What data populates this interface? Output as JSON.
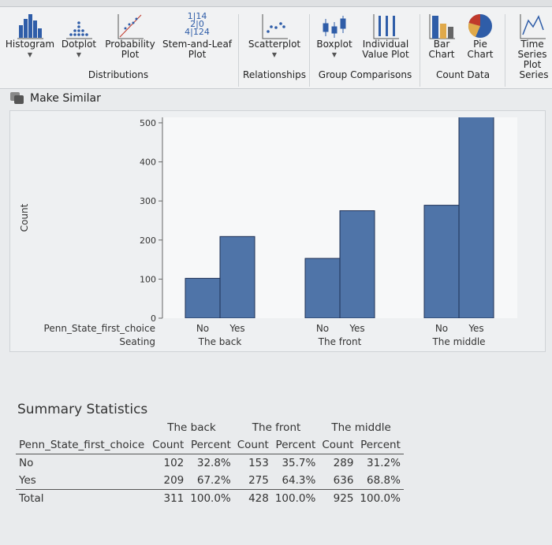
{
  "ribbon": {
    "tools": [
      {
        "label": "Histogram",
        "icon": "histogram-icon"
      },
      {
        "label": "Dotplot",
        "icon": "dotplot-icon"
      },
      {
        "label": "Probability Plot",
        "icon": "probability-plot-icon"
      },
      {
        "label": "Stem-and-Leaf Plot",
        "icon": "stem-leaf-icon"
      },
      {
        "label": "Scatterplot",
        "icon": "scatterplot-icon"
      },
      {
        "label": "Boxplot",
        "icon": "boxplot-icon"
      },
      {
        "label": "Individual Value Plot",
        "icon": "individual-value-plot-icon"
      },
      {
        "label": "Bar Chart",
        "icon": "bar-chart-icon"
      },
      {
        "label": "Pie Chart",
        "icon": "pie-chart-icon"
      },
      {
        "label": "Time Series Plot",
        "icon": "time-series-icon"
      }
    ],
    "stem_leaf_text": [
      "1|14",
      "2|0",
      "4|124"
    ],
    "groups": [
      "Distributions",
      "Relationships",
      "Group Comparisons",
      "Count Data",
      "Series"
    ],
    "make_similar": "Make Similar"
  },
  "chart_data": {
    "type": "bar",
    "ylabel": "Count",
    "ylim": [
      0,
      514
    ],
    "yticks": [
      0,
      100,
      200,
      300,
      400,
      500
    ],
    "x_row_label_1": "Penn_State_first_choice",
    "x_row_label_2": "Seating",
    "groups": [
      "The back",
      "The front",
      "The middle"
    ],
    "categories": [
      "No",
      "Yes"
    ],
    "values": [
      [
        102,
        209
      ],
      [
        153,
        275
      ],
      [
        289,
        636
      ]
    ],
    "bar_color": "#4f74a8"
  },
  "summary": {
    "title": "Summary Statistics",
    "groups": [
      "The back",
      "The front",
      "The middle"
    ],
    "row_header": "Penn_State_first_choice",
    "col_headers": [
      "Count",
      "Percent"
    ],
    "rows": [
      {
        "label": "No",
        "cells": [
          "102",
          "32.8%",
          "153",
          "35.7%",
          "289",
          "31.2%"
        ]
      },
      {
        "label": "Yes",
        "cells": [
          "209",
          "67.2%",
          "275",
          "64.3%",
          "636",
          "68.8%"
        ]
      },
      {
        "label": "Total",
        "cells": [
          "311",
          "100.0%",
          "428",
          "100.0%",
          "925",
          "100.0%"
        ]
      }
    ]
  }
}
